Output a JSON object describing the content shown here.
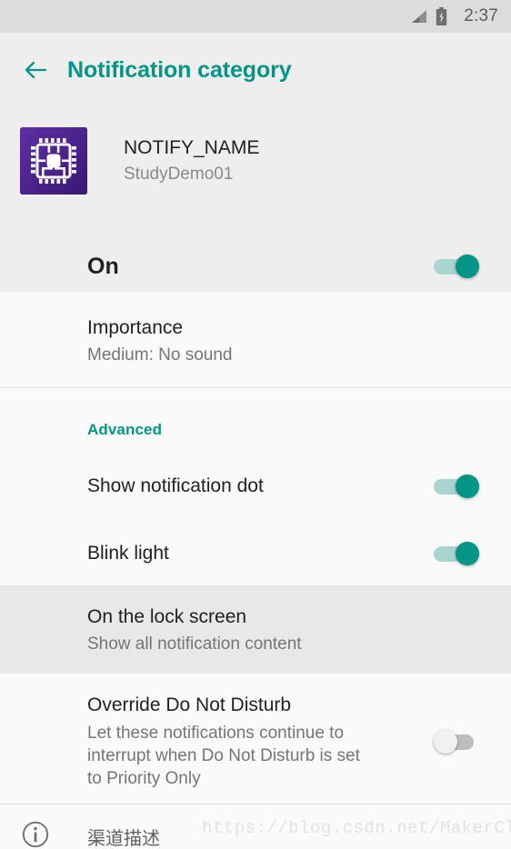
{
  "status_bar": {
    "time": "2:37",
    "signal_icon": "signal-cellular-icon",
    "battery_icon": "battery-charging-icon"
  },
  "app_bar": {
    "back_icon": "back-arrow-icon",
    "title": "Notification category"
  },
  "app_header": {
    "icon": "microchip-app-icon",
    "name": "NOTIFY_NAME",
    "package": "StudyDemo01",
    "master_toggle": {
      "label": "On",
      "state": "on"
    }
  },
  "settings": {
    "importance": {
      "title": "Importance",
      "value": "Medium: No sound"
    },
    "advanced_label": "Advanced",
    "show_notification_dot": {
      "title": "Show notification dot",
      "state": "on"
    },
    "blink_light": {
      "title": "Blink light",
      "state": "on"
    },
    "lock_screen": {
      "title": "On the lock screen",
      "value": "Show all notification content"
    },
    "override_dnd": {
      "title": "Override Do Not Disturb",
      "description": "Let these notifications continue to interrupt when Do Not Disturb is set to Priority Only",
      "state": "off"
    },
    "channel_description": {
      "icon": "info-circle-icon",
      "label": "渠道描述"
    }
  },
  "watermark": {
    "text": "https://blog.csdn.net/MakerCloud"
  },
  "colors": {
    "accent_teal": "#009688",
    "switch_on_thumb": "#009587",
    "switch_on_track": "#A8D5CF",
    "switch_off_track": "#BDBDBD",
    "header_background": "#EEEEEE",
    "page_background": "#FAFAFA",
    "app_icon_purple": "#4B2391"
  }
}
